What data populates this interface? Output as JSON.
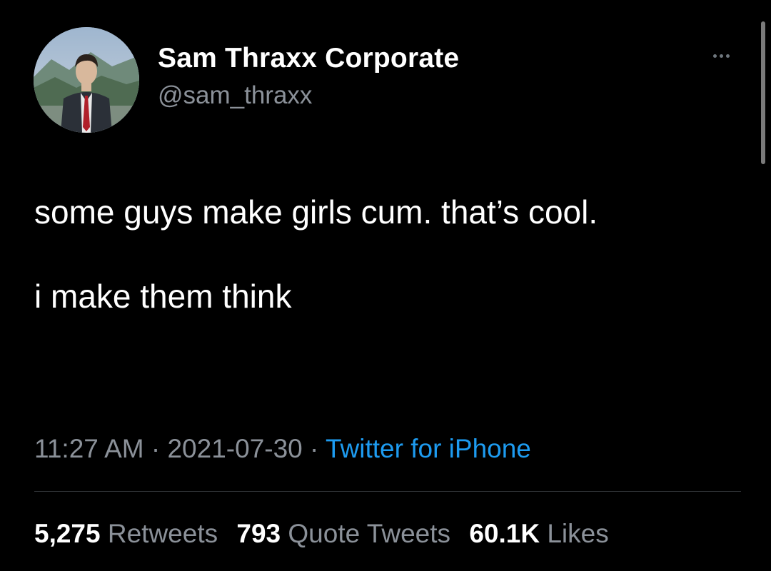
{
  "colors": {
    "background": "#000000",
    "primary_text": "#ffffff",
    "secondary_text": "#8b9199",
    "accent": "#1d9bf0",
    "divider": "#2f3336"
  },
  "author": {
    "display_name": "Sam Thraxx Corporate",
    "handle": "@sam_thraxx",
    "avatar_icon": "profile-photo"
  },
  "more_menu": {
    "icon": "more-horizontal-icon"
  },
  "tweet": {
    "paragraphs": [
      "some guys make girls cum. that’s cool.",
      "i make them think"
    ]
  },
  "meta": {
    "time": "11:27 AM",
    "separator": " · ",
    "date": "2021-07-30",
    "source": "Twitter for iPhone"
  },
  "stats": {
    "retweets_count": "5,275",
    "retweets_label": "Retweets",
    "quotes_count": "793",
    "quotes_label": "Quote Tweets",
    "likes_count": "60.1K",
    "likes_label": "Likes"
  }
}
